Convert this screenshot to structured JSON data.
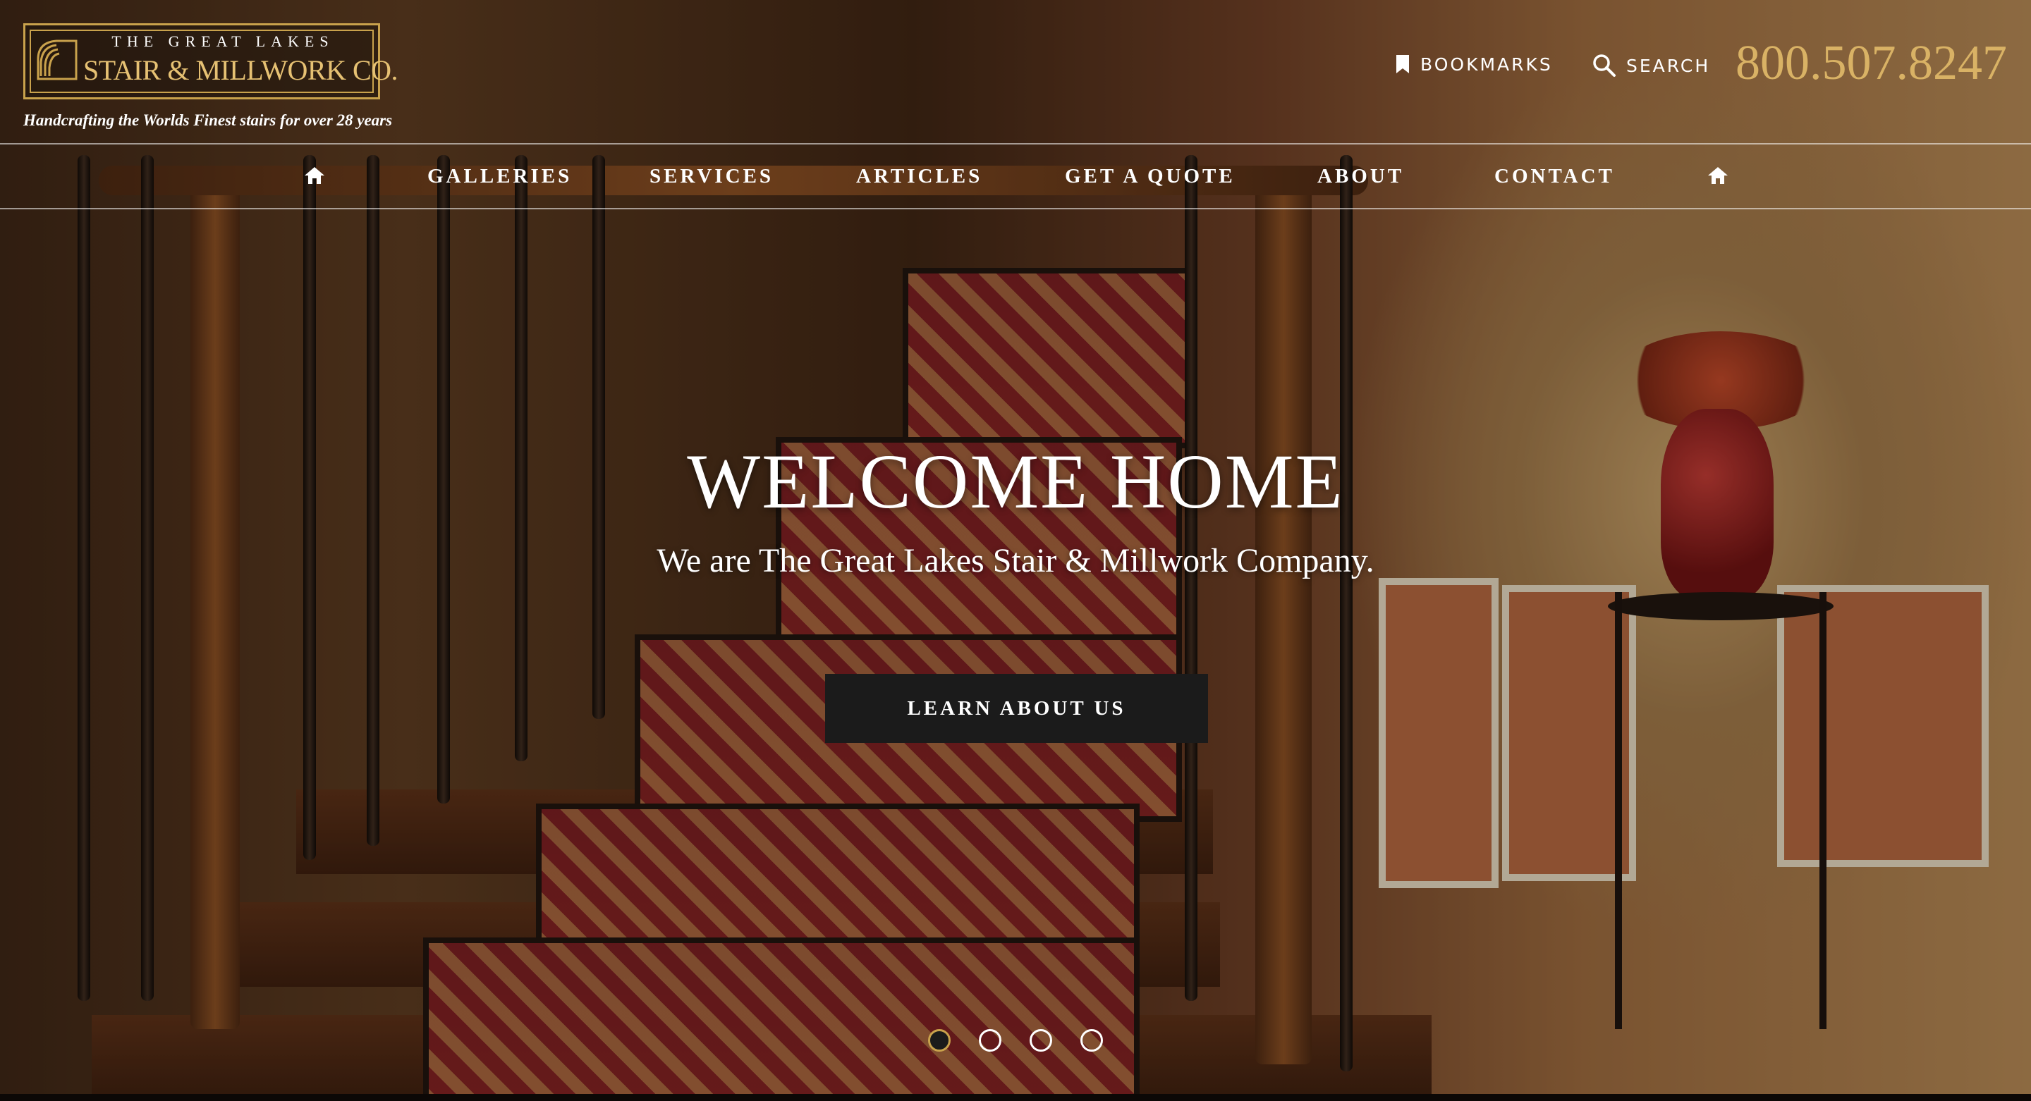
{
  "brand": {
    "logo_top": "THE GREAT LAKES",
    "logo_main": "STAIR & MILLWORK CO.",
    "tagline": "Handcrafting the Worlds Finest stairs for over 28 years",
    "logo_mark": "stair-emblem-icon",
    "accent_color": "#c9a24c"
  },
  "utility": {
    "bookmarks_label": "BOOKMARKS",
    "bookmarks_icon": "bookmark-icon",
    "search_label": "SEARCH",
    "search_icon": "search-icon",
    "phone": "800.507.8247",
    "phone_color": "#d9b265"
  },
  "nav": {
    "home_icon": "home-icon",
    "items": [
      {
        "label": "GALLERIES"
      },
      {
        "label": "SERVICES"
      },
      {
        "label": "ARTICLES"
      },
      {
        "label": "GET A QUOTE"
      },
      {
        "label": "ABOUT"
      },
      {
        "label": "CONTACT"
      }
    ]
  },
  "hero": {
    "headline": "WELCOME HOME",
    "subhead": "We are The Great Lakes Stair & Millwork Company.",
    "cta_label": "LEARN ABOUT US",
    "background": "staircase-foyer-photo"
  },
  "slider": {
    "total_slides": 4,
    "active_slide": 1
  }
}
